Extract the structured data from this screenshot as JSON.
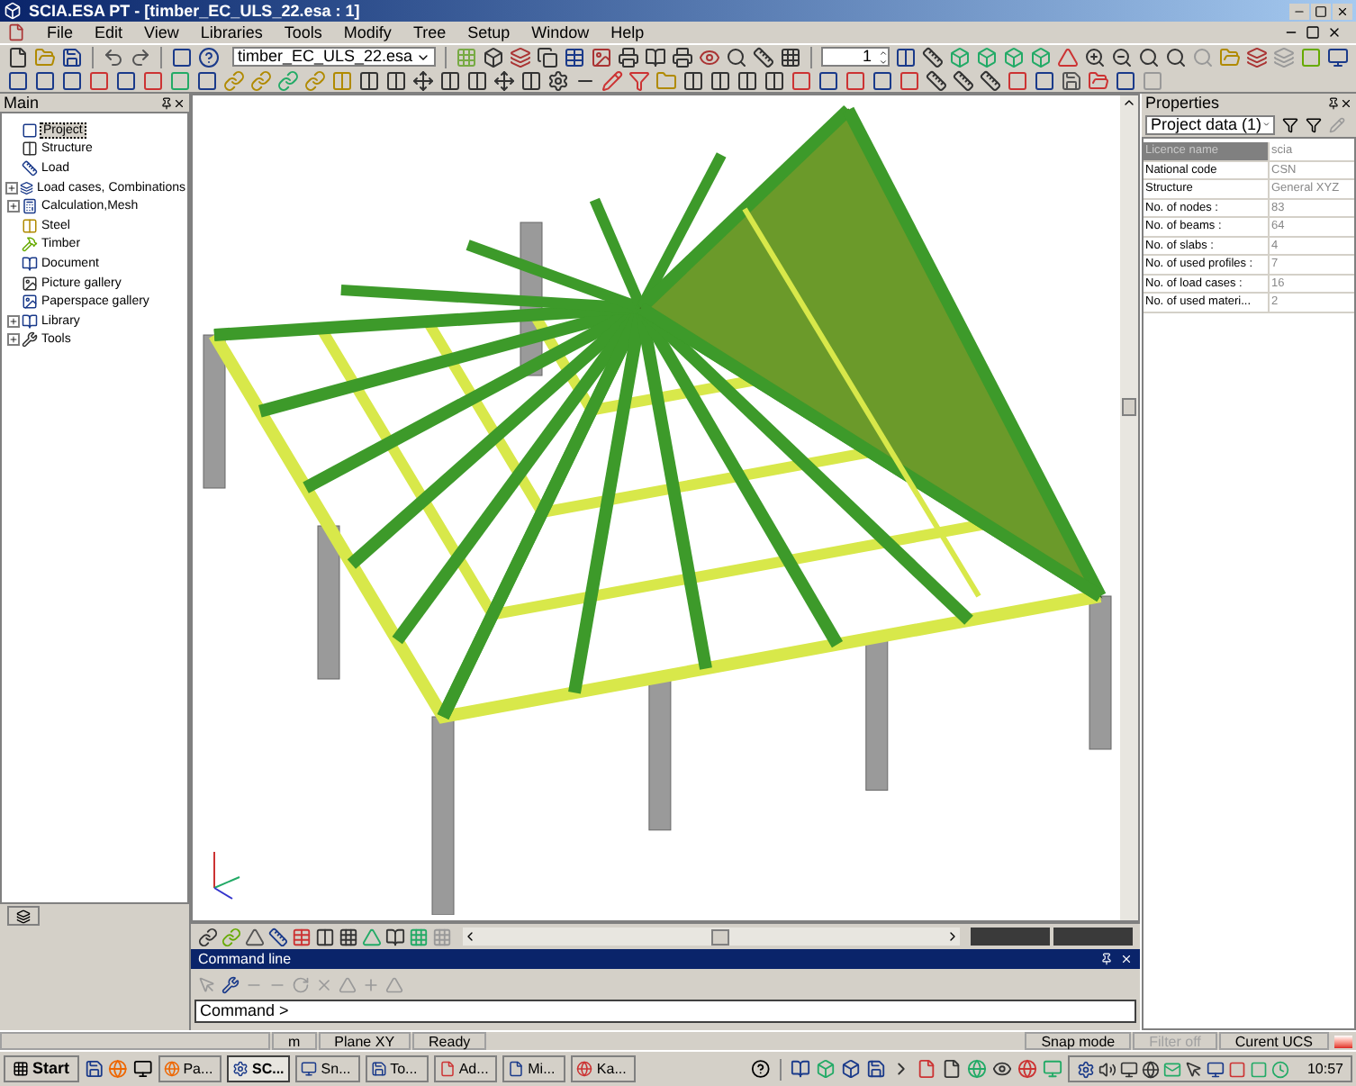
{
  "window": {
    "title": "SCIA.ESA PT - [timber_EC_ULS_22.esa : 1]"
  },
  "menu": [
    "File",
    "Edit",
    "View",
    "Libraries",
    "Tools",
    "Modify",
    "Tree",
    "Setup",
    "Window",
    "Help"
  ],
  "toolbar": {
    "file_combo": "timber_EC_ULS_22.esa",
    "spin_value": "1"
  },
  "main_panel": {
    "title": "Main",
    "items": [
      {
        "label": "Project",
        "selected": true,
        "expander": false
      },
      {
        "label": "Structure",
        "selected": false,
        "expander": false
      },
      {
        "label": "Load",
        "selected": false,
        "expander": false
      },
      {
        "label": "Load cases, Combinations",
        "selected": false,
        "expander": true
      },
      {
        "label": "Calculation,Mesh",
        "selected": false,
        "expander": true
      },
      {
        "label": "Steel",
        "selected": false,
        "expander": false
      },
      {
        "label": "Timber",
        "selected": false,
        "expander": false
      },
      {
        "label": "Document",
        "selected": false,
        "expander": false
      },
      {
        "label": "Picture gallery",
        "selected": false,
        "expander": false
      },
      {
        "label": "Paperspace gallery",
        "selected": false,
        "expander": false
      },
      {
        "label": "Library",
        "selected": false,
        "expander": true
      },
      {
        "label": "Tools",
        "selected": false,
        "expander": true
      }
    ]
  },
  "properties": {
    "title": "Properties",
    "combo": "Project data (1)",
    "rows": [
      {
        "name": "Licence name",
        "value": "scia",
        "selected": true
      },
      {
        "name": "National code",
        "value": "CSN",
        "selected": false
      },
      {
        "name": "Structure",
        "value": "General XYZ",
        "selected": false
      },
      {
        "name": "No. of nodes :",
        "value": "83",
        "selected": false
      },
      {
        "name": "No. of beams :",
        "value": "64",
        "selected": false
      },
      {
        "name": "No. of slabs :",
        "value": "4",
        "selected": false
      },
      {
        "name": "No. of used profiles :",
        "value": "7",
        "selected": false
      },
      {
        "name": "No. of load cases :",
        "value": "16",
        "selected": false
      },
      {
        "name": "No. of used materi...",
        "value": "2",
        "selected": false
      }
    ]
  },
  "command_line": {
    "title": "Command line",
    "value": "Command >"
  },
  "status_bar": [
    {
      "text": "m",
      "disabled": false
    },
    {
      "text": "Plane XY",
      "disabled": false
    },
    {
      "text": "Ready",
      "disabled": false
    },
    {
      "text": "Snap mode",
      "disabled": false
    },
    {
      "text": "Filter off",
      "disabled": true
    },
    {
      "text": "Curent UCS",
      "disabled": false
    }
  ],
  "taskbar": {
    "start": "Start",
    "tasks": [
      {
        "label": "Pa...",
        "selected": false
      },
      {
        "label": "SC...",
        "selected": true
      },
      {
        "label": "Sn...",
        "selected": false
      },
      {
        "label": "To...",
        "selected": false
      },
      {
        "label": "Ad...",
        "selected": false
      },
      {
        "label": "Mi...",
        "selected": false
      },
      {
        "label": "Ka...",
        "selected": false
      }
    ],
    "clock": "10:57"
  }
}
